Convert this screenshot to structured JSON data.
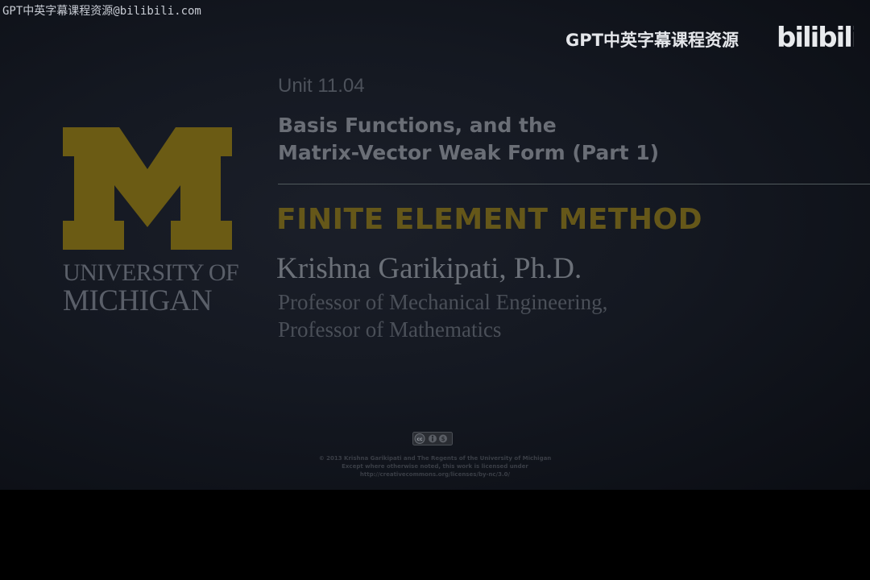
{
  "watermark": {
    "top_left": "GPT中英字幕课程资源@bilibili.com",
    "top_right": "GPT中英字幕课程资源",
    "logo_text": "bilibili"
  },
  "branding": {
    "logo_letter": "M",
    "university_line1": "UNIVERSITY OF",
    "university_line2": "MICHIGAN"
  },
  "slide": {
    "unit": "Unit 11.04",
    "title_line1": "Basis Functions, and the",
    "title_line2": "Matrix-Vector Weak Form (Part 1)",
    "course": "FINITE ELEMENT METHOD",
    "instructor": "Krishna Garikipati, Ph.D.",
    "role_line1": "Professor of Mechanical Engineering,",
    "role_line2": "Professor of Mathematics"
  },
  "license": {
    "badge_icon": "creative-commons-by-nc-icon",
    "line1": "© 2013 Krishna Garikipati and The Regents of the University of Michigan",
    "line2": "Except where otherwise noted, this work is licensed under",
    "line3": "http://creativecommons.org/licenses/by-nc/3.0/"
  },
  "colors": {
    "maize": "#6b5b14",
    "background": "#141821"
  }
}
